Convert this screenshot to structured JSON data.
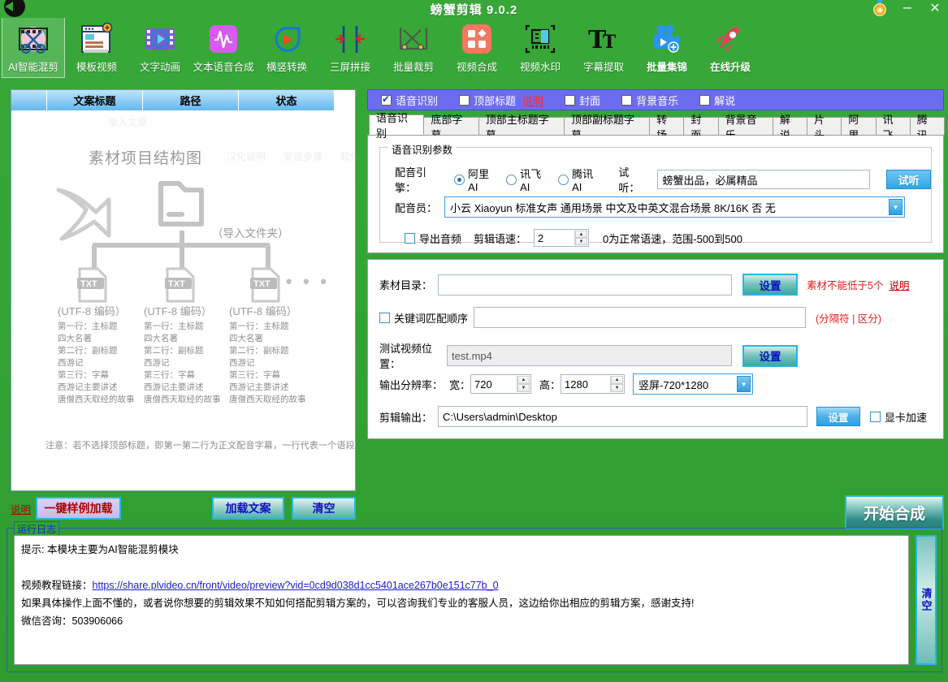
{
  "window": {
    "title": "螃蟹剪辑 9.0.2",
    "minimize": "−",
    "close": "✕",
    "medal_icon": "medal-icon"
  },
  "toolbar": {
    "items": [
      {
        "label": "AI智能混剪",
        "icon": "ai-mix-cut-icon",
        "selected": true
      },
      {
        "label": "模板视频",
        "icon": "template-video-icon",
        "selected": false
      },
      {
        "label": "文字动画",
        "icon": "text-animation-icon",
        "selected": false
      },
      {
        "label": "文本语音合成",
        "icon": "text-to-speech-icon",
        "selected": false
      },
      {
        "label": "横竖转换",
        "icon": "orientation-convert-icon",
        "selected": false
      },
      {
        "label": "三屏拼接",
        "icon": "three-screen-splice-icon",
        "selected": false
      },
      {
        "label": "批量裁剪",
        "icon": "batch-crop-icon",
        "selected": false
      },
      {
        "label": "视频合成",
        "icon": "video-compose-icon",
        "selected": false
      },
      {
        "label": "视频水印",
        "icon": "video-watermark-icon",
        "selected": false
      },
      {
        "label": "字幕提取",
        "icon": "subtitle-extract-icon",
        "selected": false
      },
      {
        "label": "批量集锦",
        "icon": "batch-highlights-icon",
        "selected": false
      },
      {
        "label": "在线升级",
        "icon": "online-upgrade-icon",
        "selected": false
      }
    ]
  },
  "left_panel": {
    "columns": [
      "",
      "文案标题",
      "路径",
      "状态",
      ""
    ],
    "diagram": {
      "title": "素材项目结构图",
      "import_label": "（导入文件夹）",
      "arrow_icon": "arrow-right-icon",
      "folder_icon": "folder-icon",
      "txt_icon": "txt-file-icon",
      "ellipsis": "● ● ●",
      "files": [
        {
          "encoding": "(UTF-8 编码）",
          "lines": [
            "第一行：主标题",
            "四大名著",
            "第二行：副标题",
            "西游记",
            "第三行：字幕",
            "西游记主要讲述",
            "唐僧西天取经的故事"
          ]
        },
        {
          "encoding": "(UTF-8 编码）",
          "lines": [
            "第一行：主标题",
            "四大名著",
            "第二行：副标题",
            "西游记",
            "第三行：字幕",
            "西游记主要讲述",
            "唐僧西天取经的故事"
          ]
        },
        {
          "encoding": "(UTF-8 编码）",
          "lines": [
            "第一行：主标题",
            "四大名著",
            "第二行：副标题",
            "西游记",
            "第三行：字幕",
            "西游记主要讲述",
            "唐僧西天取经的故事"
          ]
        }
      ],
      "note": "注意：若不选择顶部标题，即第一第二行为正文配音字幕，一行代表一个语段",
      "ghost_texts": [
        "录入文章",
        "汉化说明",
        "安装步骤",
        "软件"
      ]
    },
    "footer": {
      "help_link": "说明",
      "sample_button": "一键样例加载",
      "load_button": "加载文案",
      "clear_button": "清空"
    }
  },
  "right_panel": {
    "checkboxes": [
      {
        "label": "语音识别",
        "checked": true,
        "link": ""
      },
      {
        "label": "顶部标题",
        "checked": false,
        "link": "说明"
      },
      {
        "label": "封面",
        "checked": false,
        "link": ""
      },
      {
        "label": "背景音乐",
        "checked": false,
        "link": ""
      },
      {
        "label": "解说",
        "checked": false,
        "link": ""
      }
    ],
    "tabs": [
      {
        "label": "语音识别",
        "active": true
      },
      {
        "label": "底部字幕",
        "active": false
      },
      {
        "label": "顶部主标题字幕",
        "active": false
      },
      {
        "label": "顶部副标题字幕",
        "active": false
      },
      {
        "label": "转场",
        "active": false
      },
      {
        "label": "封面",
        "active": false
      },
      {
        "label": "背景音乐",
        "active": false
      },
      {
        "label": "解说",
        "active": false
      },
      {
        "label": "片头",
        "active": false
      },
      {
        "label": "阿里",
        "active": false
      },
      {
        "label": "讯飞",
        "active": false
      },
      {
        "label": "腾讯",
        "active": false
      }
    ],
    "speech_group": {
      "title": "语音识别参数",
      "engine_label": "配音引擎：",
      "engines": [
        {
          "label": "阿里AI",
          "selected": true
        },
        {
          "label": "讯飞AI",
          "selected": false
        },
        {
          "label": "腾讯AI",
          "selected": false
        }
      ],
      "preview_label": "试听：",
      "preview_text": "螃蟹出品，必属精品",
      "preview_button": "试听",
      "voice_label": "配音员：",
      "voice_value": "小云 Xiaoyun 标准女声 通用场景 中文及中英文混合场景 8K/16K 否 无",
      "export_audio_label": "导出音频",
      "export_audio_checked": false,
      "speed_label": "剪辑语速：",
      "speed_value": "2",
      "speed_hint": "0为正常语速，范围-500到500"
    },
    "settings": {
      "material_label": "素材目录：",
      "material_value": "",
      "material_button": "设置",
      "material_warning": "素材不能低于5个",
      "material_link": "说明",
      "keyword_label": "关键词匹配顺序",
      "keyword_checked": false,
      "keyword_value": "",
      "keyword_hint": "(分隔符 | 区分)",
      "test_video_label": "测试视频位置：",
      "test_video_value": "test.mp4",
      "test_video_button": "设置",
      "resolution_label": "输出分辨率：",
      "width_label": "宽：",
      "width_value": "720",
      "height_label": "高：",
      "height_value": "1280",
      "preset_value": "竖屏-720*1280",
      "output_label": "剪辑输出：",
      "output_value": "C:\\Users\\admin\\Desktop",
      "output_button": "设置",
      "gpu_label": "显卡加速",
      "gpu_checked": false
    },
    "start_button": "开始合成"
  },
  "log": {
    "title": "运行日志",
    "lines": [
      {
        "text": "提示: 本模块主要为AI智能混剪模块",
        "link": ""
      },
      {
        "text": "",
        "link": ""
      },
      {
        "text": "视频教程链接：",
        "link": "https://share.plvideo.cn/front/video/preview?vid=0cd9d038d1cc5401ace267b0e151c77b_0"
      },
      {
        "text": "如果具体操作上面不懂的，或者说你想要的剪辑效果不知如何搭配剪辑方案的，可以咨询我们专业的客服人员，这边给你出相应的剪辑方案，感谢支持!",
        "link": ""
      },
      {
        "text": "微信咨询：503906066",
        "link": ""
      }
    ],
    "clear_button": "清空"
  },
  "colors": {
    "brand_green": "#35a436",
    "accent_blue": "#2fa6e8",
    "purple_bar": "#6c6cf0",
    "warning_red": "#e21d1d",
    "link_blue": "#1a1ae0"
  }
}
